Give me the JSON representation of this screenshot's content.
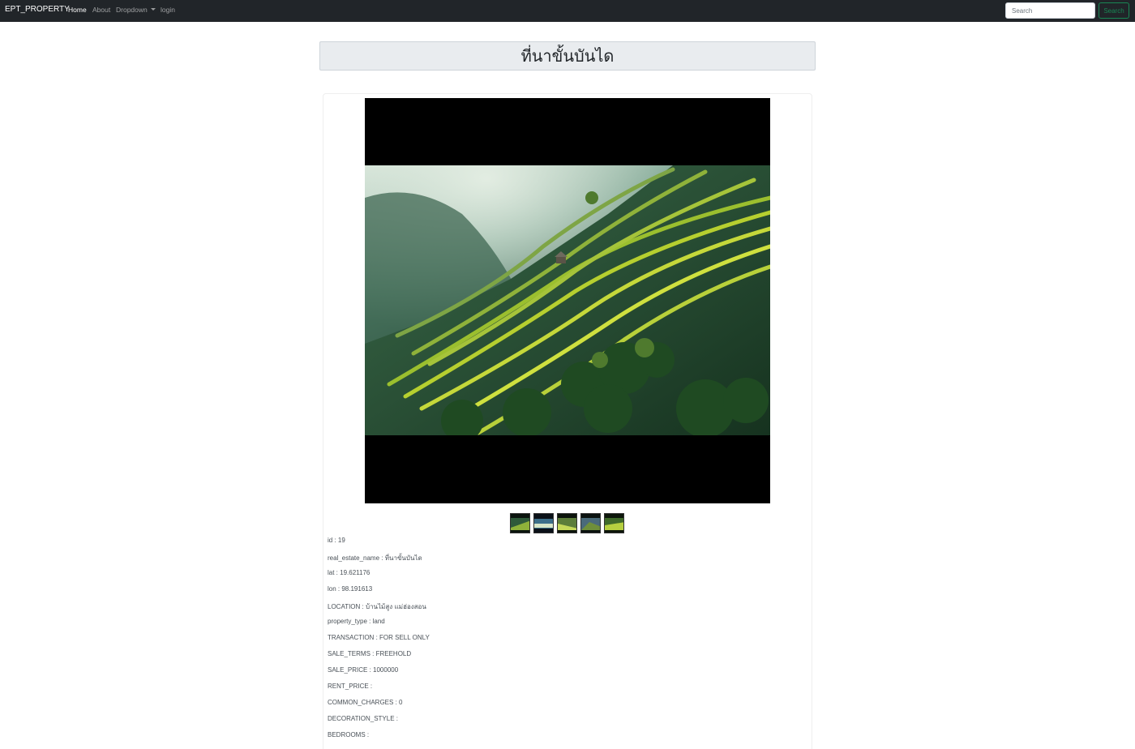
{
  "navbar": {
    "brand": "EPT_PROPERTY",
    "links": {
      "home": "Home",
      "about": "About",
      "dropdown": "Dropdown",
      "login": "login"
    },
    "search_placeholder": "Search",
    "search_button": "Search"
  },
  "page": {
    "title": "ที่นาขั้นบันได"
  },
  "gallery": {
    "main_image_alt": "rice-terraces-photo",
    "thumbnail_count": 5
  },
  "details": [
    {
      "label": "id",
      "value": "19"
    },
    {
      "label": "real_estate_name",
      "value": "ที่นาขั้นบันได"
    },
    {
      "label": "lat",
      "value": "19.621176"
    },
    {
      "label": "lon",
      "value": "98.191613"
    },
    {
      "label": "LOCATION",
      "value": "บ้านไม้สูง แม่ฮ่องสอน"
    },
    {
      "label": "property_type",
      "value": "land"
    },
    {
      "label": "TRANSACTION",
      "value": "FOR SELL ONLY"
    },
    {
      "label": "SALE_TERMS",
      "value": "FREEHOLD"
    },
    {
      "label": "SALE_PRICE",
      "value": "1000000"
    },
    {
      "label": "RENT_PRICE",
      "value": ""
    },
    {
      "label": "COMMON_CHARGES",
      "value": "0"
    },
    {
      "label": "DECORATION_STYLE",
      "value": ""
    },
    {
      "label": "BEDROOMS",
      "value": ""
    }
  ],
  "colors": {
    "navbar_bg": "#212529",
    "success": "#198754",
    "title_bg": "#e9ecef"
  }
}
